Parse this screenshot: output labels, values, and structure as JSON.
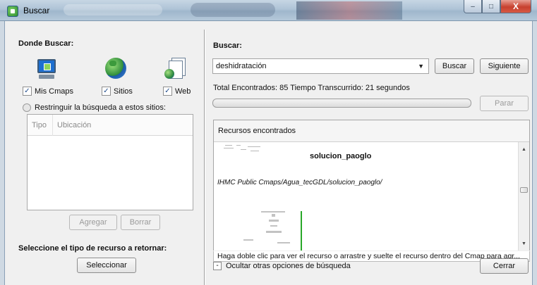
{
  "window": {
    "title": "Buscar",
    "min_symbol": "–",
    "max_symbol": "□",
    "close_symbol": "X"
  },
  "left": {
    "where_heading": "Donde Buscar:",
    "sources": [
      {
        "label": "Mis Cmaps",
        "checked": true,
        "icon": "monitor-icon"
      },
      {
        "label": "Sitios",
        "checked": true,
        "icon": "globe-icon"
      },
      {
        "label": "Web",
        "checked": true,
        "icon": "web-document-icon"
      }
    ],
    "check_mark": "✓",
    "restrict_label": "Restringuir la búsqueda a estos sitios:",
    "table_headers": [
      "Tipo",
      "Ubicación"
    ],
    "add_button": "Agregar",
    "delete_button": "Borrar",
    "resource_type_heading": "Seleccione el tipo de recurso a retornar:",
    "select_button": "Seleccionar"
  },
  "right": {
    "search_heading": "Buscar:",
    "query": "deshidratación",
    "dropdown_arrow": "▼",
    "search_button": "Buscar",
    "next_button": "Siguiente",
    "status": "Total Encontrados: 85 Tiempo Transcurrido: 21 segundos",
    "progress": 0,
    "stop_button": "Parar",
    "results_header": "Recursos encontrados",
    "result": {
      "title": "solucion_paoglo",
      "path": "IHMC Public Cmaps/Agua_tecGDL/solucion_paoglo/"
    },
    "scroll_up": "▲",
    "scroll_down": "▼",
    "hint": "Haga doble clic para ver el recurso o arrastre y suelte el recurso dentro del Cmap para agr...",
    "toggle_symbol": "-",
    "hide_options_label": "Ocultar otras opciones de búsqueda",
    "close_button": "Cerrar"
  },
  "colors": {
    "progress_fill": "#4bb84b",
    "thumbnail_line": "#29a829"
  }
}
